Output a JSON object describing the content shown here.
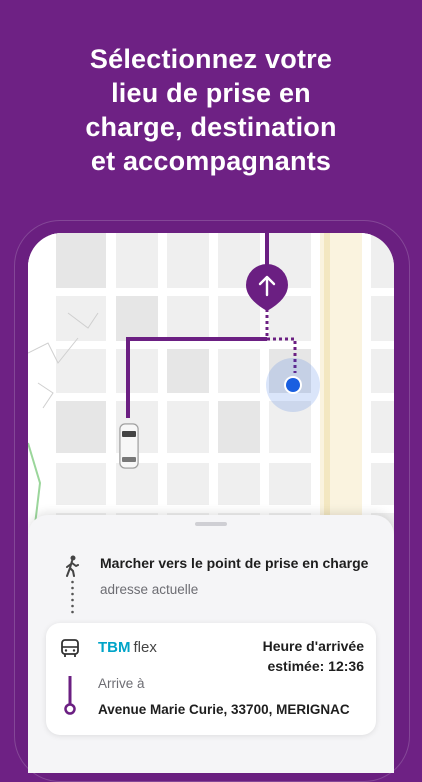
{
  "headline": {
    "line1": "Sélectionnez votre",
    "line2": "lieu de prise en",
    "line3": "charge, destination",
    "line4": "et accompagnants"
  },
  "colors": {
    "brand_purple": "#6e2184",
    "route_purple": "#6b1f82",
    "location_blue": "#1a5fe0"
  },
  "map": {
    "icons": [
      "pickup-arrow-icon",
      "current-location-icon",
      "vehicle-icon"
    ]
  },
  "walk_step": {
    "icon": "walking-person-icon",
    "title": "Marcher vers le point de prise en charge",
    "subtitle": "adresse actuelle"
  },
  "ride_card": {
    "icon": "bus-icon",
    "brand_tbm": "TBM",
    "brand_flex": "flex",
    "arrival_line1": "Heure d'arrivée",
    "arrival_line2": "estimée: 12:36",
    "arrive_label": "Arrive à",
    "arrive_address": "Avenue Marie Curie, 33700, MERIGNAC"
  }
}
